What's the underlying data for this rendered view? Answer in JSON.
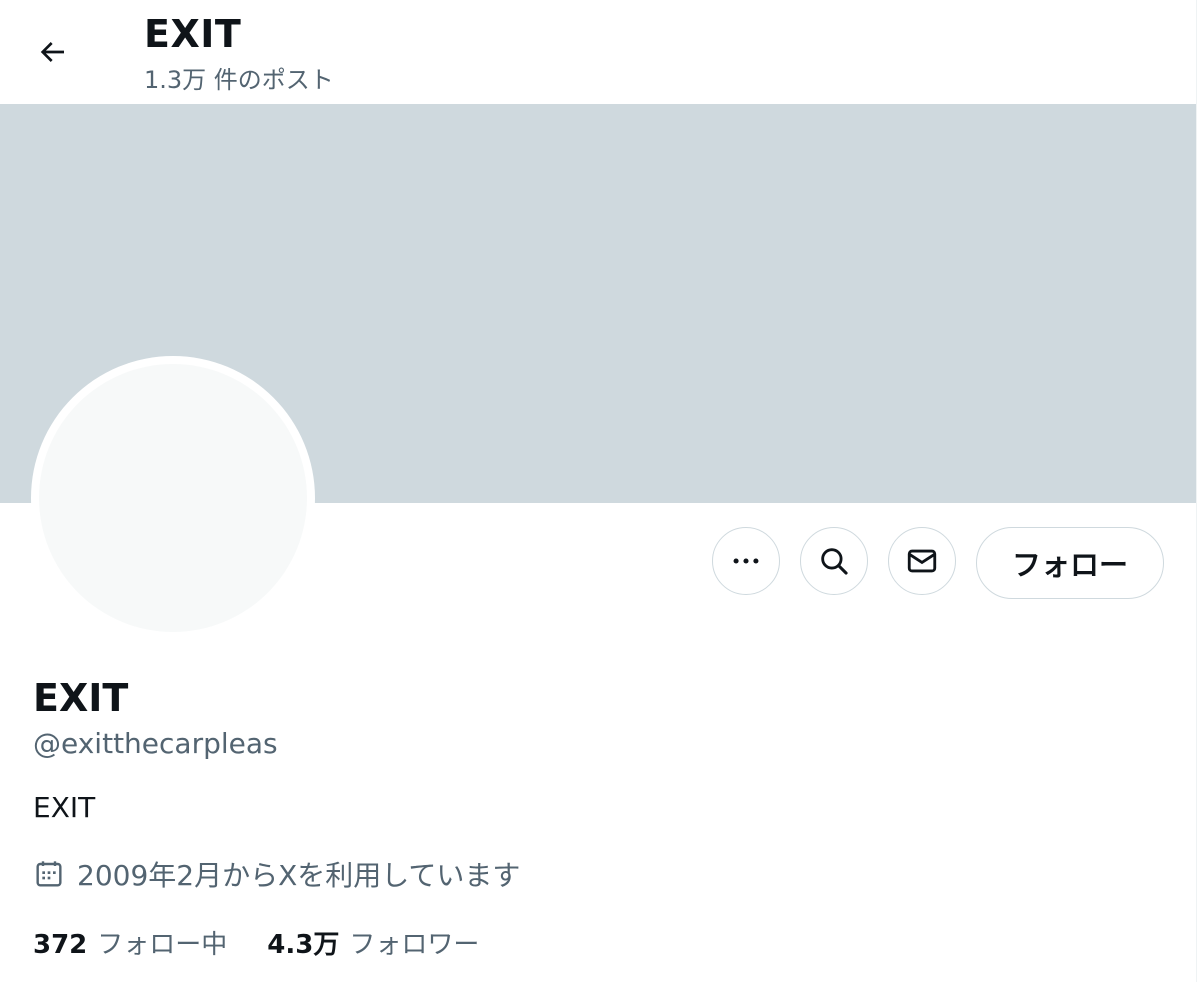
{
  "header": {
    "title": "EXIT",
    "post_count": "1.3万 件のポスト",
    "back_icon": "arrow-left-icon"
  },
  "colors": {
    "banner": "#cfd9de",
    "text_primary": "#0f1419",
    "text_secondary": "#536471",
    "border": "#cfd9de"
  },
  "actions": {
    "more_icon": "more-horizontal-icon",
    "search_icon": "search-icon",
    "message_icon": "envelope-icon",
    "follow_label": "フォロー"
  },
  "profile": {
    "display_name": "EXIT",
    "handle": "@exitthecarpleas",
    "bio": "EXIT",
    "joined_icon": "calendar-icon",
    "joined": "2009年2月からXを利用しています"
  },
  "stats": {
    "following_count": "372",
    "following_label": "フォロー中",
    "followers_count": "4.3万",
    "followers_label": "フォロワー"
  }
}
